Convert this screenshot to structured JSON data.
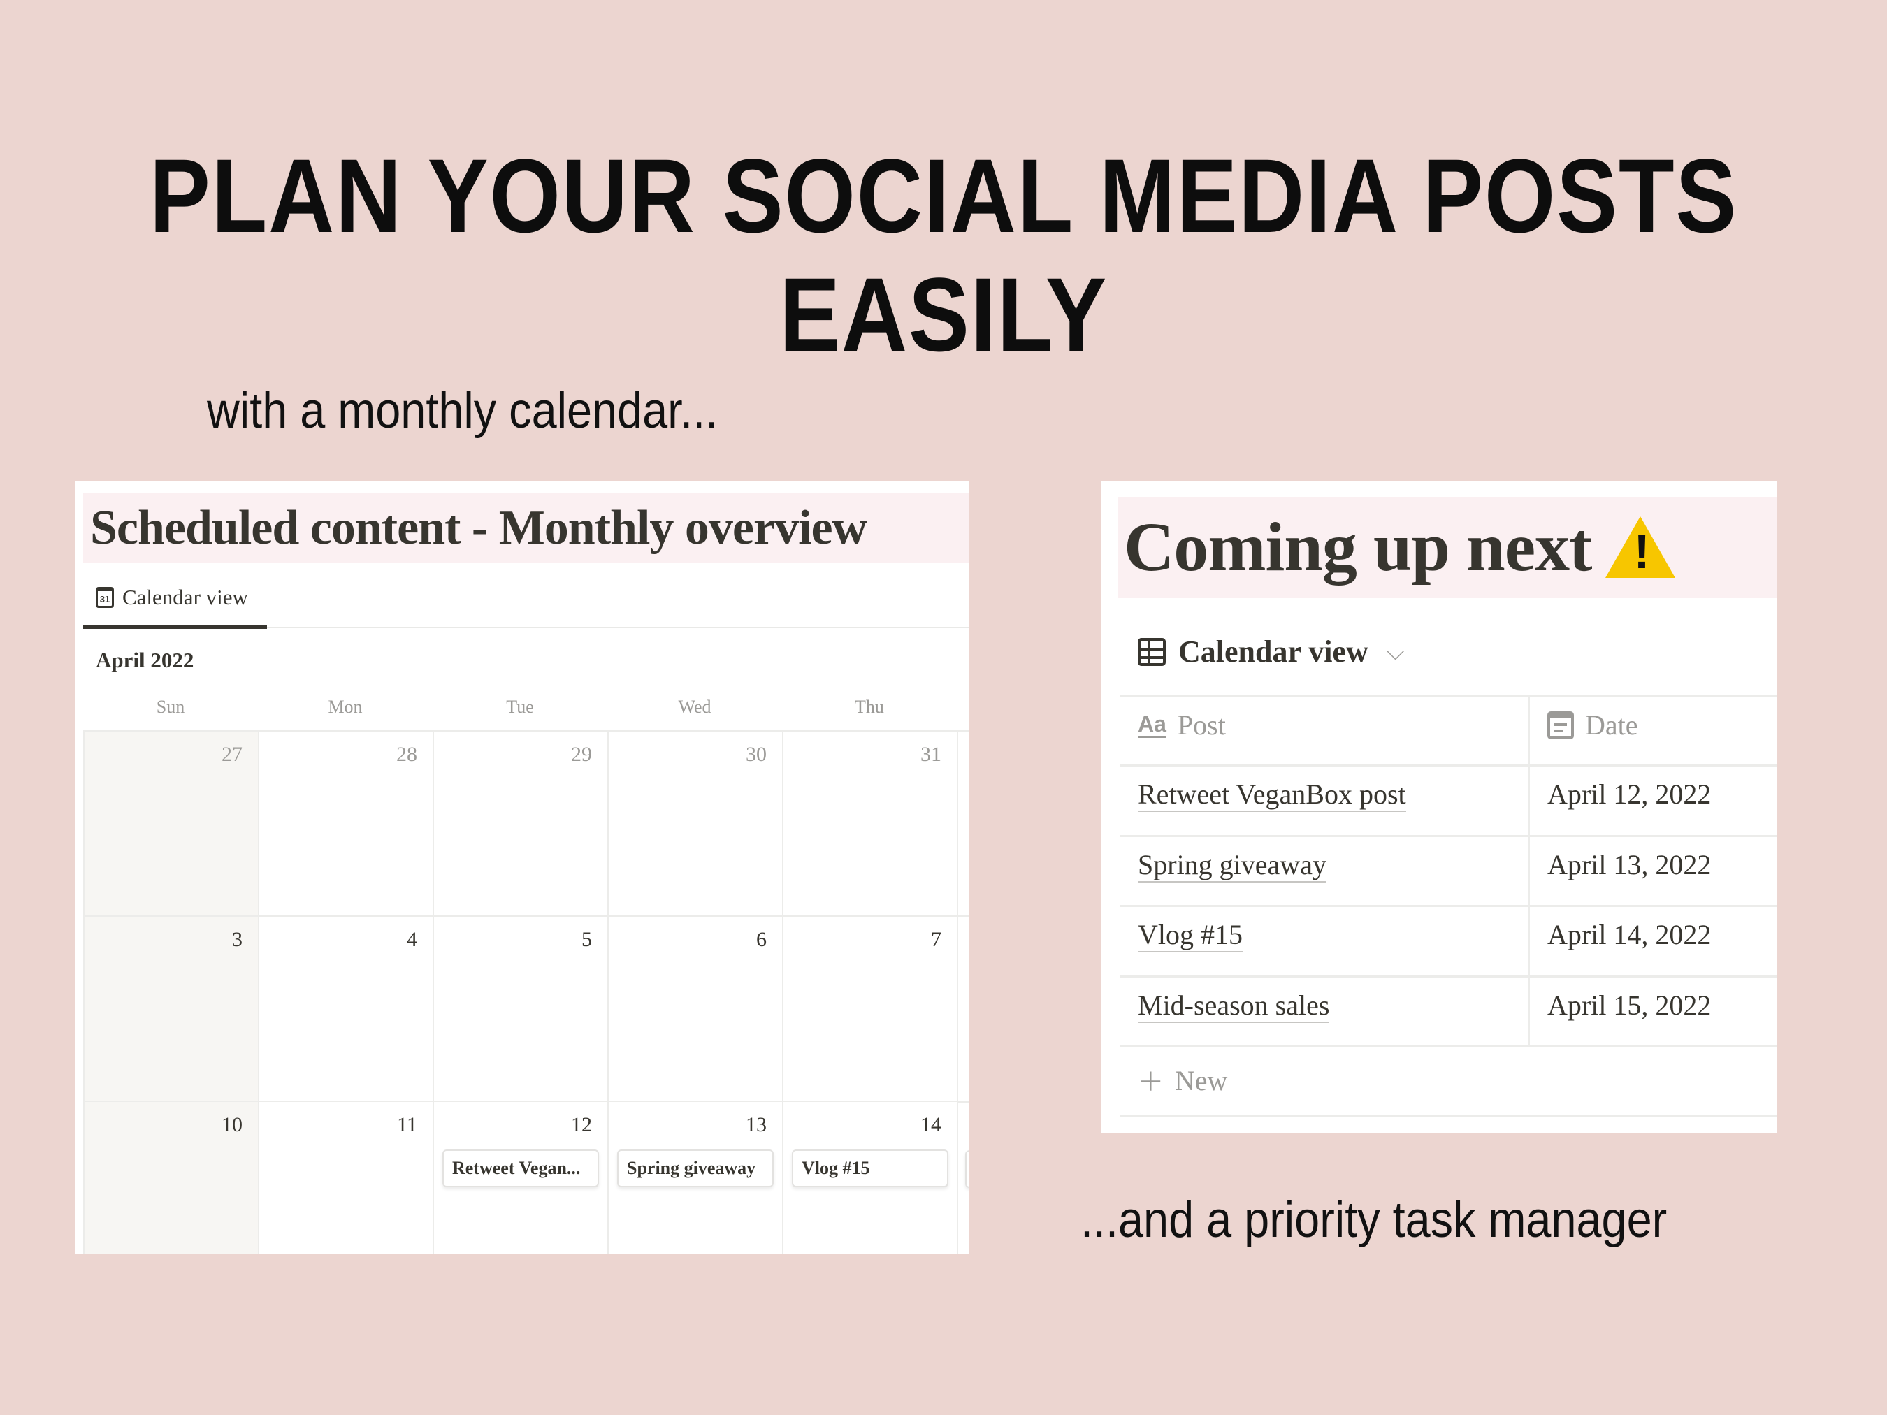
{
  "headline": "PLAN YOUR SOCIAL MEDIA POSTS EASILY",
  "caption_left": "with a monthly calendar...",
  "caption_right": "...and a priority task manager",
  "calendar": {
    "title": "Scheduled content - Monthly overview",
    "tab_label": "Calendar view",
    "tab_icon": "calendar-31-icon",
    "month": "April 2022",
    "weekdays": [
      "Sun",
      "Mon",
      "Tue",
      "Wed",
      "Thu"
    ],
    "weeks": [
      [
        {
          "d": "27",
          "prev": true
        },
        {
          "d": "28",
          "prev": true
        },
        {
          "d": "29",
          "prev": true
        },
        {
          "d": "30",
          "prev": true
        },
        {
          "d": "31",
          "prev": true
        }
      ],
      [
        {
          "d": "3"
        },
        {
          "d": "4"
        },
        {
          "d": "5"
        },
        {
          "d": "6"
        },
        {
          "d": "7"
        }
      ],
      [
        {
          "d": "10"
        },
        {
          "d": "11"
        },
        {
          "d": "12",
          "card": "Retweet Vegan..."
        },
        {
          "d": "13",
          "card": "Spring giveaway"
        },
        {
          "d": "14",
          "card": "Vlog #15"
        }
      ]
    ]
  },
  "tasks": {
    "title": "Coming up next",
    "title_icon": "warning-icon",
    "view_label": "Calendar view",
    "columns": {
      "post": "Post",
      "date": "Date"
    },
    "rows": [
      {
        "post": "Retweet VeganBox post",
        "date": "April 12, 2022"
      },
      {
        "post": "Spring giveaway",
        "date": "April 13, 2022"
      },
      {
        "post": "Vlog #15",
        "date": "April 14, 2022"
      },
      {
        "post": "Mid-season sales",
        "date": "April 15, 2022"
      }
    ],
    "new_label": "New"
  },
  "colors": {
    "background": "#ecd5d0",
    "title_band": "#fbf0f2",
    "text": "#37352f",
    "muted": "#9b9a97",
    "warning": "#f7c600"
  }
}
